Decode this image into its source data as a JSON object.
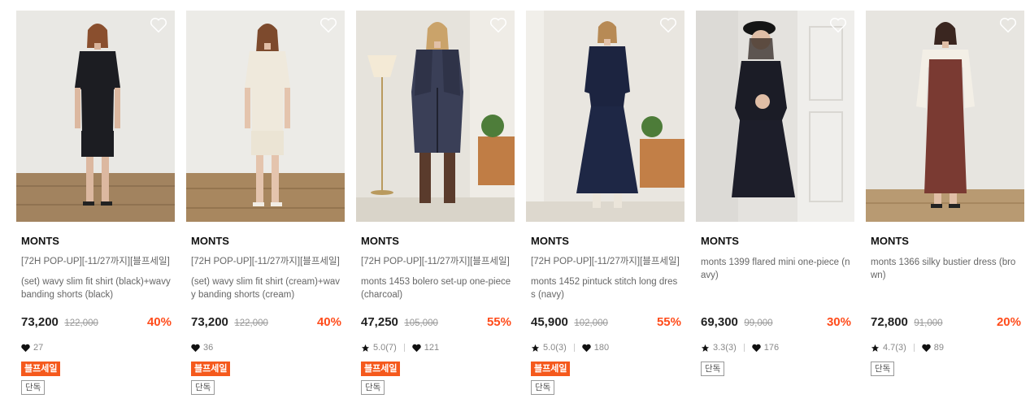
{
  "colors": {
    "accent": "#ff4c1b",
    "sale_badge": "#f5591c",
    "text": "#222222",
    "muted": "#888888"
  },
  "icons": {
    "wishlist": "heart-outline-icon",
    "likes": "heart-icon",
    "rating": "star-icon"
  },
  "products": [
    {
      "brand": "MONTS",
      "promo": "[72H POP-UP][-11/27까지][블프세일]",
      "name": "(set) wavy slim fit shirt (black)+wavy banding shorts (black)",
      "price": "73,200",
      "original_price": "122,000",
      "discount": "40%",
      "rating": "",
      "likes": "27",
      "badges": [
        "블프세일",
        "단독"
      ]
    },
    {
      "brand": "MONTS",
      "promo": "[72H POP-UP][-11/27까지][블프세일]",
      "name": "(set) wavy slim fit shirt (cream)+wavy banding shorts (cream)",
      "price": "73,200",
      "original_price": "122,000",
      "discount": "40%",
      "rating": "",
      "likes": "36",
      "badges": [
        "블프세일",
        "단독"
      ]
    },
    {
      "brand": "MONTS",
      "promo": "[72H POP-UP][-11/27까지][블프세일]",
      "name": "monts 1453 bolero set-up one-piece (charcoal)",
      "price": "47,250",
      "original_price": "105,000",
      "discount": "55%",
      "rating": "5.0(7)",
      "likes": "121",
      "badges": [
        "블프세일",
        "단독"
      ]
    },
    {
      "brand": "MONTS",
      "promo": "[72H POP-UP][-11/27까지][블프세일]",
      "name": "monts 1452 pintuck stitch long dress (navy)",
      "price": "45,900",
      "original_price": "102,000",
      "discount": "55%",
      "rating": "5.0(3)",
      "likes": "180",
      "badges": [
        "블프세일",
        "단독"
      ]
    },
    {
      "brand": "MONTS",
      "promo": "",
      "name": "monts 1399 flared mini one-piece (navy)",
      "price": "69,300",
      "original_price": "99,000",
      "discount": "30%",
      "rating": "3.3(3)",
      "likes": "176",
      "badges": [
        "단독"
      ]
    },
    {
      "brand": "MONTS",
      "promo": "",
      "name": "monts 1366 silky bustier dress (brown)",
      "price": "72,800",
      "original_price": "91,000",
      "discount": "20%",
      "rating": "4.7(3)",
      "likes": "89",
      "badges": [
        "단독"
      ]
    }
  ]
}
